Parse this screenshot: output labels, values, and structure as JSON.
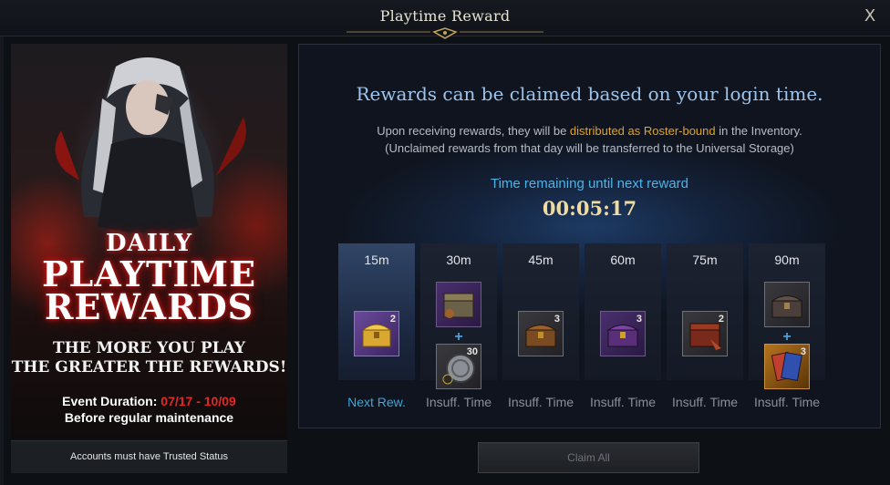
{
  "window": {
    "title": "Playtime Reward",
    "close_label": "X"
  },
  "banner": {
    "line1": "DAILY",
    "line2": "PLAYTIME",
    "line3": "REWARDS",
    "tagline1": "THE MORE YOU PLAY",
    "tagline2": "THE GREATER THE REWARDS!",
    "duration_label": "Event Duration: ",
    "duration_dates": "07/17 - 10/09",
    "maintenance": "Before regular maintenance",
    "trusted_notice": "Accounts must have Trusted Status"
  },
  "panel": {
    "headline": "Rewards can be claimed based on your login time.",
    "info_prefix": "Upon receiving rewards, they will be ",
    "info_highlight": "distributed as Roster-bound",
    "info_suffix": " in the Inventory.",
    "info_line2": "(Unclaimed rewards from that day will be transferred to the Universal Storage)",
    "countdown_label": "Time remaining until next reward",
    "countdown": "00:05:17",
    "highlight_color": "#e0a422",
    "accent_color": "#3aa7e0"
  },
  "slots": [
    {
      "time": "15m",
      "status": "Next Rew.",
      "items": [
        {
          "icon": "gold-chest-icon",
          "count": "2"
        }
      ]
    },
    {
      "time": "30m",
      "status": "Insuff. Time",
      "items": [
        {
          "icon": "supply-chest-icon",
          "count": ""
        },
        {
          "icon": "silver-coin-icon",
          "count": "30"
        }
      ]
    },
    {
      "time": "45m",
      "status": "Insuff. Time",
      "items": [
        {
          "icon": "bronze-chest-icon",
          "count": "3"
        }
      ]
    },
    {
      "time": "60m",
      "status": "Insuff. Time",
      "items": [
        {
          "icon": "purple-chest-icon",
          "count": "3"
        }
      ]
    },
    {
      "time": "75m",
      "status": "Insuff. Time",
      "items": [
        {
          "icon": "red-chest-icon",
          "count": "2"
        }
      ]
    },
    {
      "time": "90m",
      "status": "Insuff. Time",
      "items": [
        {
          "icon": "dark-chest-icon",
          "count": ""
        },
        {
          "icon": "card-pack-icon",
          "count": "3"
        }
      ]
    }
  ],
  "claim_all_label": "Claim All"
}
